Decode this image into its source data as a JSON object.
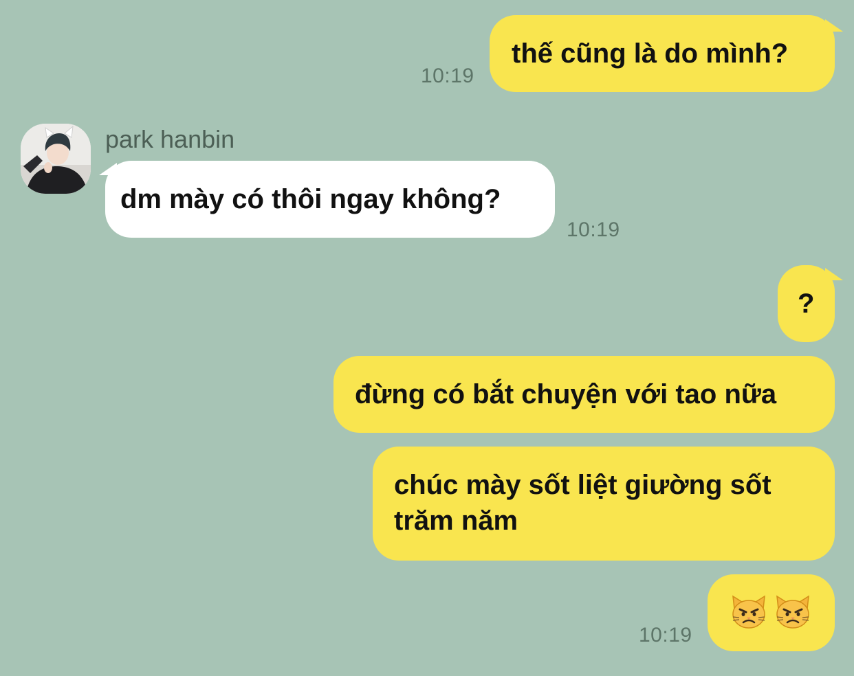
{
  "sender": {
    "name": "park hanbin"
  },
  "messages": [
    {
      "from": "me",
      "text": "thế cũng là do mình?",
      "time": "10:19"
    },
    {
      "from": "them",
      "text": "dm mày có thôi ngay không?",
      "time": "10:19"
    },
    {
      "from": "me",
      "text": "?"
    },
    {
      "from": "me",
      "text": "đừng có bắt chuyện với tao nữa"
    },
    {
      "from": "me",
      "text": "chúc mày sốt liệt giường sốt trăm năm"
    },
    {
      "from": "me",
      "text": "",
      "emoji": [
        "pouting-cat",
        "pouting-cat"
      ],
      "time": "10:19"
    }
  ],
  "colors": {
    "background": "#a7c4b5",
    "my_bubble": "#f9e54f",
    "their_bubble": "#ffffff",
    "timestamp": "#5d7568",
    "sender_name": "#4c5f55"
  }
}
